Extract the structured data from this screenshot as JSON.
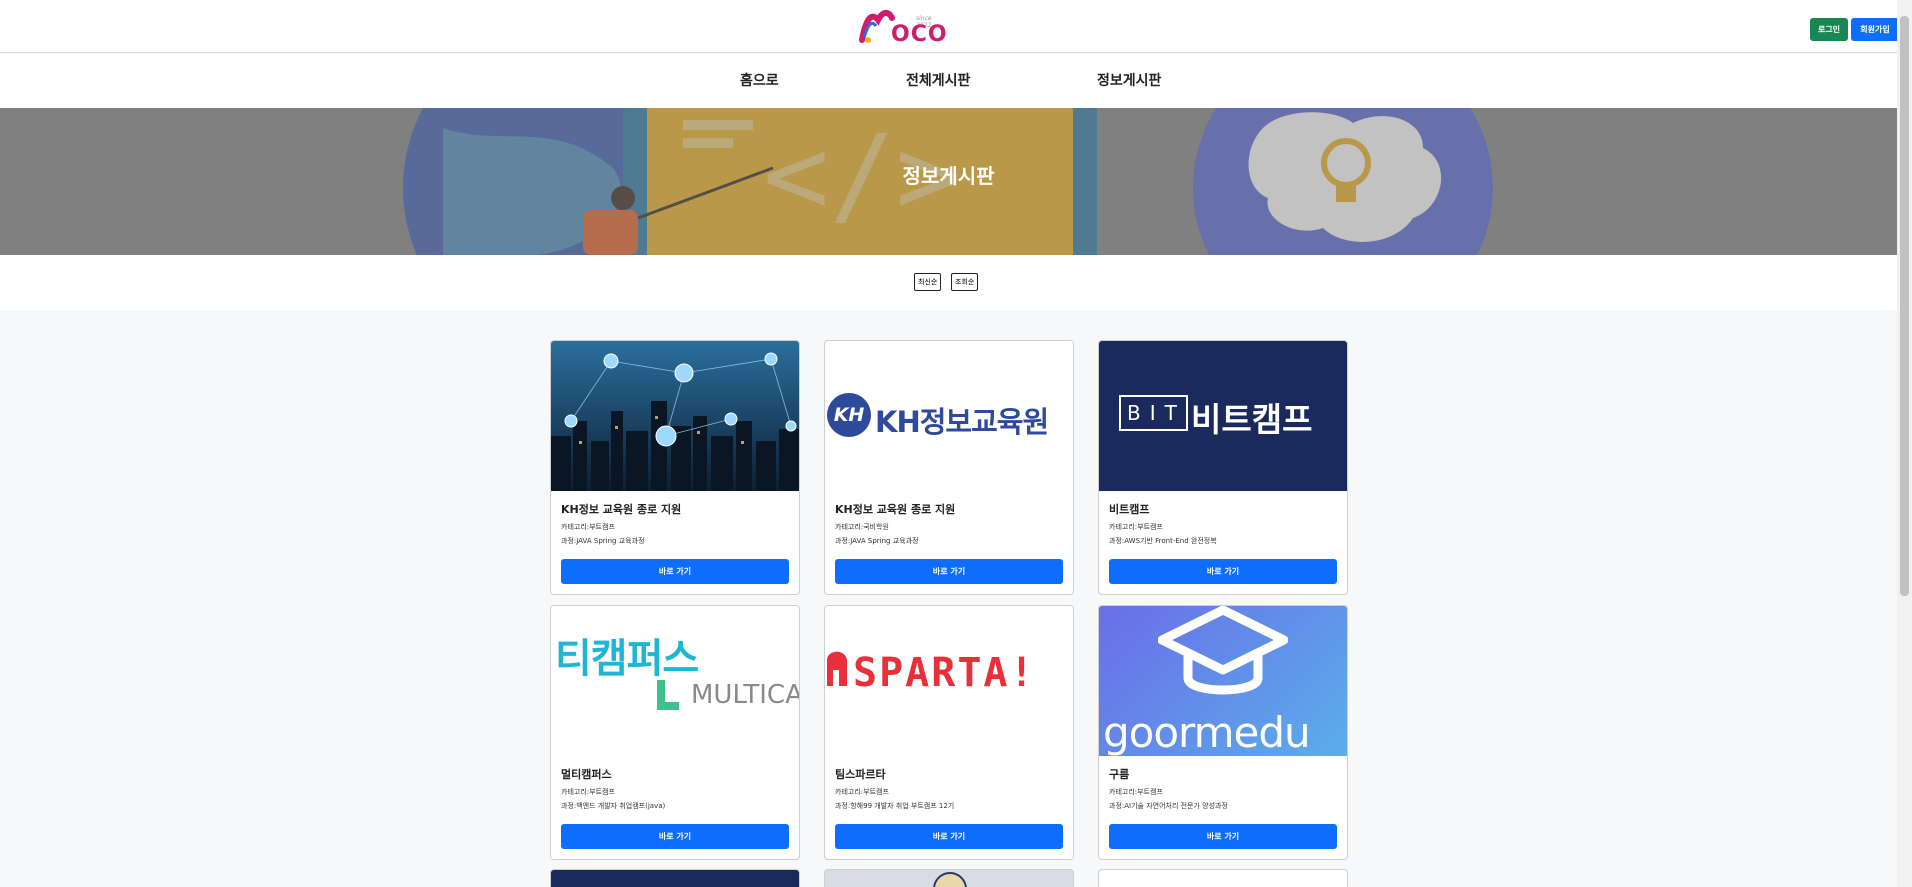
{
  "header": {
    "logo_text": "OCO",
    "logo_tag": "since 2022",
    "login_label": "로그인",
    "signup_label": "회원가입"
  },
  "nav": {
    "home": "홈으로",
    "all_board": "전체게시판",
    "info_board": "정보게시판"
  },
  "hero": {
    "title": "정보게시판"
  },
  "sort": {
    "latest": "최신순",
    "views": "조회순"
  },
  "cards": [
    {
      "title": "KH정보 교육원 종로 지원",
      "category": "카테고리:부트캠프",
      "course": "과정:JAVA Spring 교육과정",
      "button": "바로 가기",
      "image": "city-network"
    },
    {
      "title": "KH정보 교육원 종로 지원",
      "category": "카테고리:국비학원",
      "course": "과정:JAVA Spring 교육과정",
      "button": "바로 가기",
      "image": "kh-logo",
      "logo_text": "KH정보교육원",
      "logo_mark": "KH"
    },
    {
      "title": "비트캠프",
      "category": "카테고리:부트캠프",
      "course": "과정:AWS기반 Front-End 완전정복",
      "button": "바로 가기",
      "image": "bit-logo",
      "logo_mark": "BIT",
      "logo_text": "비트캠프"
    },
    {
      "title": "멀티캠퍼스",
      "category": "카테고리:부트캠프",
      "course": "과정:백엔드 개발자 취업캠프(java)",
      "button": "바로 가기",
      "image": "multicampus-logo",
      "logo_text": "티캠퍼스",
      "logo_sub": "MULTICA"
    },
    {
      "title": "팀스파르타",
      "category": "카테고리:부트캠프",
      "course": "과정:항해99 개발자 취업 부트캠프 12기",
      "button": "바로 가기",
      "image": "sparta-logo",
      "logo_text": "SPARTA!"
    },
    {
      "title": "구름",
      "category": "카테고리:부트캠프",
      "course": "과정:AI기술 자연어처리 전문가 양성과정",
      "button": "바로 가기",
      "image": "goorm-logo",
      "logo_text": "goormedu"
    }
  ],
  "colors": {
    "primary": "#0d6efd",
    "success": "#198754",
    "bit_navy": "#1b2a5c",
    "kh_blue": "#2e4a9c",
    "sparta_red": "#e8303b"
  }
}
